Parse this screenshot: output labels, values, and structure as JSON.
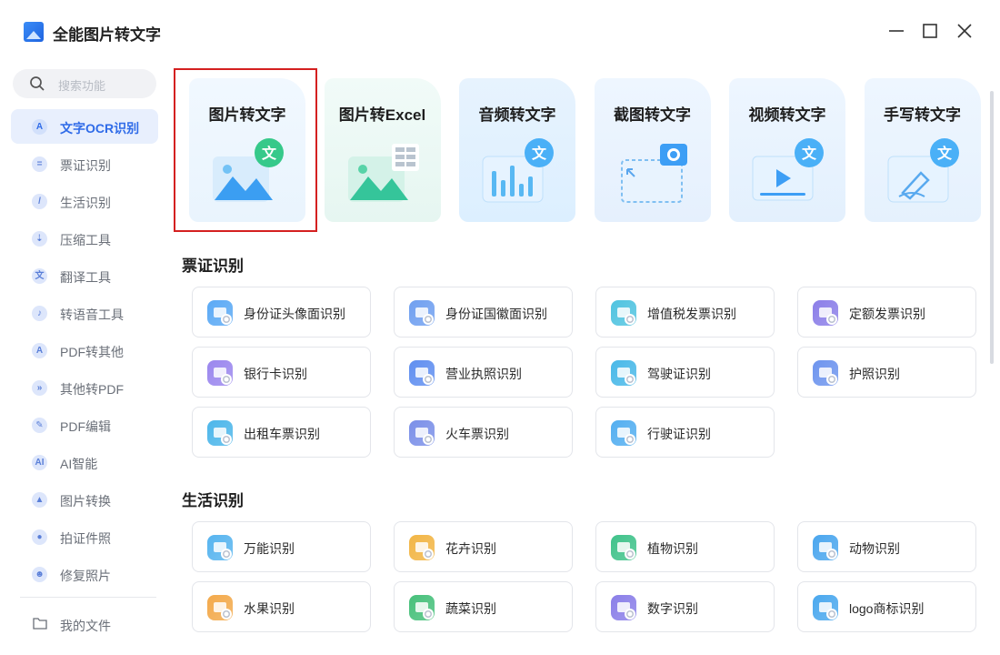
{
  "app": {
    "title": "全能图片转文字"
  },
  "sidebar": {
    "search_placeholder": "搜索功能",
    "items": [
      {
        "label": "文字OCR识别",
        "icon": "ocr-icon",
        "glyph": "A",
        "active": true
      },
      {
        "label": "票证识别",
        "icon": "ticket-icon",
        "glyph": "=",
        "active": false
      },
      {
        "label": "生活识别",
        "icon": "life-icon",
        "glyph": "/",
        "active": false
      },
      {
        "label": "压缩工具",
        "icon": "compress-icon",
        "glyph": "⇣",
        "active": false
      },
      {
        "label": "翻译工具",
        "icon": "translate-icon",
        "glyph": "文",
        "active": false
      },
      {
        "label": "转语音工具",
        "icon": "speech-icon",
        "glyph": "♪",
        "active": false
      },
      {
        "label": "PDF转其他",
        "icon": "pdf-export-icon",
        "glyph": "A",
        "active": false
      },
      {
        "label": "其他转PDF",
        "icon": "pdf-import-icon",
        "glyph": "»",
        "active": false
      },
      {
        "label": "PDF编辑",
        "icon": "pdf-edit-icon",
        "glyph": "✎",
        "active": false
      },
      {
        "label": "AI智能",
        "icon": "ai-icon",
        "glyph": "AI",
        "active": false
      },
      {
        "label": "图片转换",
        "icon": "image-convert-icon",
        "glyph": "▲",
        "active": false
      },
      {
        "label": "拍证件照",
        "icon": "id-photo-icon",
        "glyph": "●",
        "active": false
      },
      {
        "label": "修复照片",
        "icon": "repair-photo-icon",
        "glyph": "☻",
        "active": false
      }
    ],
    "files_label": "我的文件"
  },
  "feature_cards": [
    {
      "title": "图片转文字",
      "icon": "image-to-text-icon",
      "selected": true
    },
    {
      "title": "图片转Excel",
      "icon": "image-to-excel-icon",
      "selected": false
    },
    {
      "title": "音频转文字",
      "icon": "audio-to-text-icon",
      "selected": false
    },
    {
      "title": "截图转文字",
      "icon": "screenshot-to-text-icon",
      "selected": false
    },
    {
      "title": "视频转文字",
      "icon": "video-to-text-icon",
      "selected": false
    },
    {
      "title": "手写转文字",
      "icon": "handwriting-to-text-icon",
      "selected": false
    }
  ],
  "sections": [
    {
      "title": "票证识别",
      "tools": [
        {
          "label": "身份证头像面识别",
          "icon": "id-card-front-icon",
          "color": "#5aa9f5"
        },
        {
          "label": "身份证国徽面识别",
          "icon": "id-card-back-icon",
          "color": "#6f9ff0"
        },
        {
          "label": "增值税发票识别",
          "icon": "vat-invoice-icon",
          "color": "#4fc3e0"
        },
        {
          "label": "定额发票识别",
          "icon": "fixed-invoice-icon",
          "color": "#8b7ee8"
        },
        {
          "label": "银行卡识别",
          "icon": "bank-card-icon",
          "color": "#9a86ee"
        },
        {
          "label": "营业执照识别",
          "icon": "business-license-icon",
          "color": "#5f8ef0"
        },
        {
          "label": "驾驶证识别",
          "icon": "driver-license-icon",
          "color": "#48b8e8"
        },
        {
          "label": "护照识别",
          "icon": "passport-icon",
          "color": "#6d94ee"
        },
        {
          "label": "出租车票识别",
          "icon": "taxi-ticket-icon",
          "color": "#4cb6ea"
        },
        {
          "label": "火车票识别",
          "icon": "train-ticket-icon",
          "color": "#7a8fe8"
        },
        {
          "label": "行驶证识别",
          "icon": "vehicle-license-icon",
          "color": "#52aef0"
        }
      ]
    },
    {
      "title": "生活识别",
      "tools": [
        {
          "label": "万能识别",
          "icon": "universal-icon",
          "color": "#56b4ef"
        },
        {
          "label": "花卉识别",
          "icon": "flower-icon",
          "color": "#f2b544"
        },
        {
          "label": "植物识别",
          "icon": "plant-icon",
          "color": "#3fc28a"
        },
        {
          "label": "动物识别",
          "icon": "animal-icon",
          "color": "#4aa6ee"
        },
        {
          "label": "水果识别",
          "icon": "fruit-icon",
          "color": "#f3a94a"
        },
        {
          "label": "蔬菜识别",
          "icon": "vegetable-icon",
          "color": "#46c07a"
        },
        {
          "label": "数字识别",
          "icon": "number-icon",
          "color": "#8a7ee8"
        },
        {
          "label": "logo商标识别",
          "icon": "logo-trademark-icon",
          "color": "#4aa8ee"
        }
      ]
    }
  ]
}
